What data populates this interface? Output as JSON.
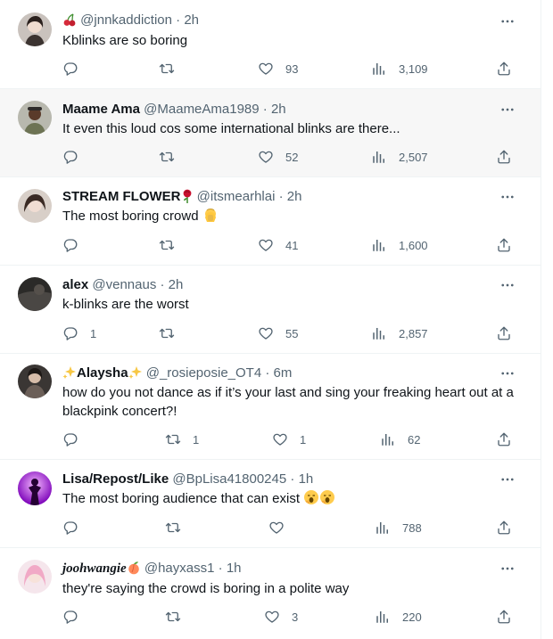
{
  "tweets": [
    {
      "name": "",
      "handle": "@jnnkaddiction",
      "time": "2h",
      "text": "Kblinks are so boring",
      "replies": "",
      "retweets": "",
      "likes": "93",
      "views": "3,109",
      "avatar_icon": "avatar-woman-icon",
      "name_emoji": "cherries-icon"
    },
    {
      "name": "Maame Ama",
      "handle": "@MaameAma1989",
      "time": "2h",
      "text": "It even this loud cos some international blinks are there...",
      "replies": "",
      "retweets": "",
      "likes": "52",
      "views": "2,507",
      "avatar_icon": "avatar-man-icon"
    },
    {
      "name": "STREAM FLOWER",
      "handle": "@itsmearhlai",
      "time": "2h",
      "text": "The most boring crowd",
      "replies": "",
      "retweets": "",
      "likes": "41",
      "views": "1,600",
      "avatar_icon": "avatar-woman-icon",
      "name_emoji": "rose-icon",
      "text_emoji": "facepalm-icon"
    },
    {
      "name": "alex",
      "handle": "@vennaus",
      "time": "2h",
      "text": "k-blinks are the worst",
      "replies": "1",
      "retweets": "",
      "likes": "55",
      "views": "2,857",
      "avatar_icon": "avatar-dark-icon"
    },
    {
      "name": "Alaysha",
      "handle": "@_rosieposie_OT4",
      "time": "6m",
      "text": "how do you not dance as if it’s your last and sing your freaking heart out at a blackpink concert?!",
      "replies": "",
      "retweets": "1",
      "likes": "1",
      "views": "62",
      "avatar_icon": "avatar-woman-icon",
      "name_emoji": "sparkles-icon"
    },
    {
      "name": "Lisa/Repost/Like",
      "handle": "@BpLisa41800245",
      "time": "1h",
      "text": "The most boring audience that can exist",
      "replies": "",
      "retweets": "",
      "likes": "",
      "views": "788",
      "avatar_icon": "avatar-silhouette-icon",
      "text_emoji": "yawning-face-icon"
    },
    {
      "name": "joohwangie",
      "handle": "@hayxass1",
      "time": "1h",
      "text": "they're saying the crowd is boring in a polite way",
      "replies": "",
      "retweets": "",
      "likes": "3",
      "views": "220",
      "avatar_icon": "avatar-woman-icon",
      "name_emoji": "peach-icon"
    }
  ],
  "separator": "·",
  "colors": {
    "text": "#0f1419",
    "muted": "#536471",
    "border": "#eff3f4",
    "highlight_row": "#f7f7f7"
  }
}
